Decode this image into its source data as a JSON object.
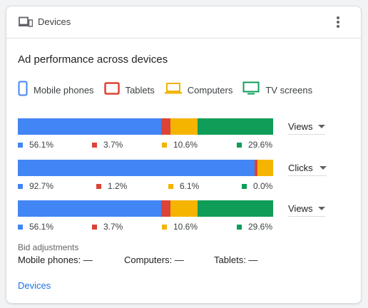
{
  "colors": {
    "mobile": "#4285f4",
    "tablets": "#db4437",
    "computers": "#f4b400",
    "tv": "#0f9d58"
  },
  "header": {
    "title": "Devices",
    "icon": "devices-icon",
    "menu_icon": "more-vert-icon"
  },
  "section_title": "Ad performance across devices",
  "legend": [
    {
      "label": "Mobile phones",
      "icon": "mobile-phone-icon"
    },
    {
      "label": "Tablets",
      "icon": "tablet-icon"
    },
    {
      "label": "Computers",
      "icon": "laptop-icon"
    },
    {
      "label": "TV screens",
      "icon": "tv-icon"
    }
  ],
  "rows": [
    {
      "metric": "Views",
      "segments": [
        56.1,
        3.7,
        10.6,
        29.6
      ],
      "labels": [
        "56.1%",
        "3.7%",
        "10.6%",
        "29.6%"
      ]
    },
    {
      "metric": "Clicks",
      "segments": [
        92.7,
        1.2,
        6.1,
        0.0
      ],
      "labels": [
        "92.7%",
        "1.2%",
        "6.1%",
        "0.0%"
      ]
    },
    {
      "metric": "Views",
      "segments": [
        56.1,
        3.7,
        10.6,
        29.6
      ],
      "labels": [
        "56.1%",
        "3.7%",
        "10.6%",
        "29.6%"
      ]
    }
  ],
  "bid_adjustments": {
    "title": "Bid adjustments",
    "items": [
      "Mobile phones: —",
      "Computers: —",
      "Tablets: —"
    ]
  },
  "footer_link": "Devices"
}
